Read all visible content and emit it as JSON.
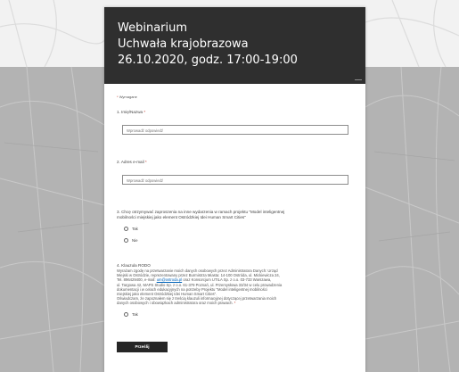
{
  "colors": {
    "header_bg": "#2f2f2f",
    "page_bg": "#b9b9b9",
    "accent_required": "#c0392b",
    "button_bg": "#262626",
    "link": "#0062b8"
  },
  "header": {
    "title": "Webinarium",
    "subtitle": "Uchwała krajobrazowa",
    "datetime": "26.10.2020, godz. 17:00-19:00"
  },
  "form": {
    "required_note": "Wymagane",
    "questions": [
      {
        "label": "1. Imię/Nazwa",
        "placeholder": "Wprowadź odpowiedź"
      },
      {
        "label": "2. Adres e-mail",
        "placeholder": "Wprowadź odpowiedź"
      }
    ],
    "q3": {
      "label_line1": "3. Chcę otrzymywać zaproszenia na inne wydarzenia w ramach projektu \"Model inteligentnej",
      "label_line2": "mobilności miejskiej jako element Ostródzkiej Idei Human Smart Cities\"",
      "options": [
        "Tak",
        "Nie"
      ]
    },
    "q4": {
      "label": "4. Klauzula RODO",
      "lines": [
        "Wyrażam zgodę na przetwarzanie moich danych osobowych przez Administratora Danych: Urząd",
        "Miejski w Ostródzie, reprezentowany przez Burmistrza Miasta: 14-100 Ostróda, ul. Mickiewicza 24,",
        "Tel. 896429400, e-mail: ",
        "ul. Targowa 42, MAPS Studio Sp. z o.o. 61-379 Poznań, ul. Przemysłowa 33/34 w celu prowadzenia",
        "dokumentacji i w celach edukacyjnych na potrzeby Projektu \"Model inteligentnej mobilności",
        "miejskiej jako element Ostródzkiej Idei Human Smart Cities\".",
        "Oświadczam, że zapoznałem się z treścią klauzuli informacyjnej dotyczącej przetwarzania moich",
        "danych osobowych i obowiązkach administratora oraz moich prawach."
      ],
      "email_link": "um@ostroda.pl",
      "line3_tail": " oraz Konsorcjum UTILA Sp. z o.o. 03-733 Warszawa,",
      "option": "Tak"
    },
    "submit_label": "Prześlij"
  }
}
